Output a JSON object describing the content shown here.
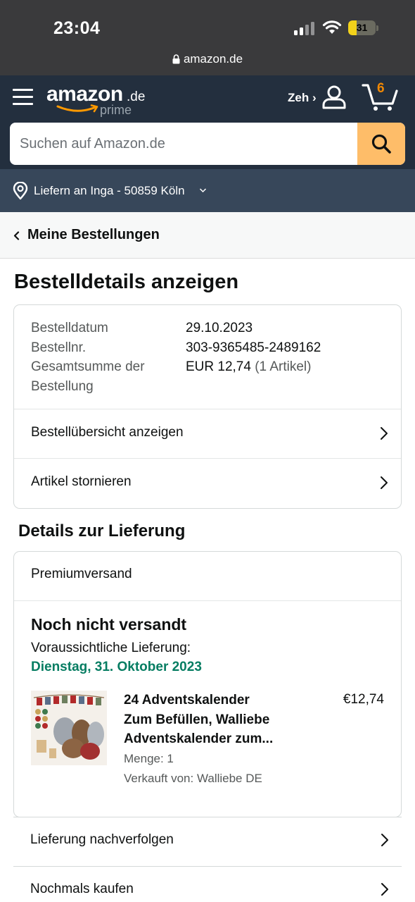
{
  "status_bar": {
    "time": "23:04",
    "battery": "31",
    "battery_level_percent": 31,
    "url": "amazon.de",
    "icons": [
      "signal-icon",
      "wifi-icon",
      "battery-charging-icon",
      "lock-icon"
    ]
  },
  "header": {
    "logo_main": "amazon",
    "logo_tld": ".de",
    "logo_sub": "prime",
    "account_label": "Zeh ›",
    "cart_count": "6",
    "icons": [
      "menu-icon",
      "account-icon",
      "cart-icon"
    ],
    "colors": {
      "nav_bg": "#232f3e",
      "subnav_bg": "#37475a",
      "search_button": "#febd69",
      "cart_count": "#f08804"
    }
  },
  "search": {
    "placeholder": "Suchen auf Amazon.de"
  },
  "delivery": {
    "label": "Liefern an Inga - 50859 Köln"
  },
  "breadcrumb": {
    "label": "Meine Bestellungen"
  },
  "page": {
    "title": "Bestelldetails anzeigen"
  },
  "order_summary": {
    "date_label": "Bestelldatum",
    "date_value": "29.10.2023",
    "number_label": "Bestellnr.",
    "number_value": "303-9365485-2489162",
    "total_label_line1": "Gesamtsumme der",
    "total_label_line2": "Bestellung",
    "total_value": "EUR 12,74",
    "total_items": "(1 Artikel)",
    "links": [
      {
        "label": "Bestellübersicht anzeigen"
      },
      {
        "label": "Artikel stornieren"
      }
    ]
  },
  "shipment": {
    "section_title": "Details zur Lieferung",
    "speed": "Premiumversand",
    "status": "Noch nicht versandt",
    "eta_label": "Voraussichtliche Lieferung:",
    "eta_date": "Dienstag, 31. Oktober 2023",
    "eta_color": "#067d62",
    "item": {
      "title_line1": "24 Adventskalender",
      "title_line2": "Zum Befüllen, Walliebe",
      "title_line3": "Adventskalender zum...",
      "price": "€12,74",
      "quantity": "Menge: 1",
      "seller": "Verkauft von: Walliebe DE"
    }
  },
  "actions": [
    {
      "label": "Lieferung nachverfolgen"
    },
    {
      "label": "Nochmals kaufen"
    }
  ]
}
